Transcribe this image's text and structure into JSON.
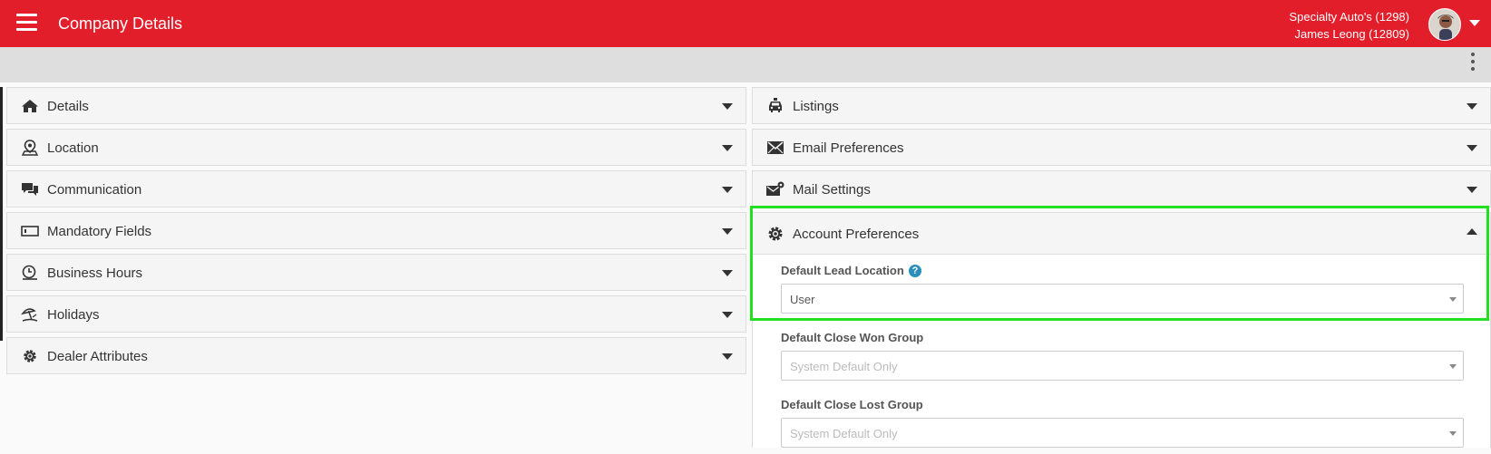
{
  "header": {
    "title": "Company Details",
    "dealer": "Specialty Auto's (1298)",
    "user": "James Leong (12809)"
  },
  "left_panels": [
    {
      "label": "Details",
      "icon": "home-icon"
    },
    {
      "label": "Location",
      "icon": "location-pin-icon"
    },
    {
      "label": "Communication",
      "icon": "chat-bubbles-icon"
    },
    {
      "label": "Mandatory Fields",
      "icon": "input-field-icon"
    },
    {
      "label": "Business Hours",
      "icon": "clock-icon"
    },
    {
      "label": "Holidays",
      "icon": "beach-umbrella-icon"
    },
    {
      "label": "Dealer Attributes",
      "icon": "gear-icon"
    }
  ],
  "right_panels": [
    {
      "label": "Listings",
      "icon": "car-icon"
    },
    {
      "label": "Email Preferences",
      "icon": "envelope-icon"
    },
    {
      "label": "Mail Settings",
      "icon": "mail-settings-icon"
    }
  ],
  "account_preferences": {
    "title": "Account Preferences",
    "fields": [
      {
        "label": "Default Lead Location",
        "value": "User",
        "has_help": true
      },
      {
        "label": "Default Close Won Group",
        "value": "System Default Only",
        "placeholder": true
      },
      {
        "label": "Default Close Lost Group",
        "value": "System Default Only",
        "placeholder": true
      }
    ]
  },
  "help_glyph": "?",
  "colors": {
    "brand_red": "#e31e2b",
    "highlight_green": "#22e01f",
    "help_blue": "#2a8fbd"
  }
}
